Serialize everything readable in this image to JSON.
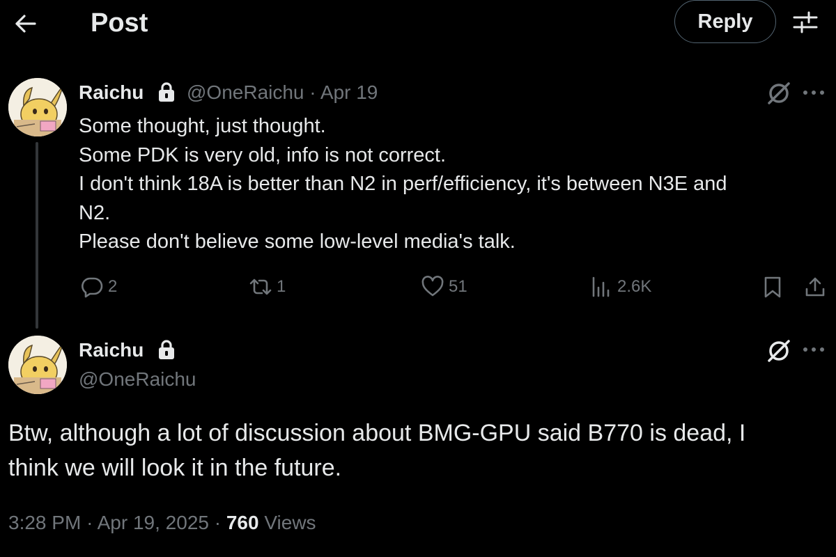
{
  "header": {
    "title": "Post",
    "reply_label": "Reply"
  },
  "tweet1": {
    "name": "Raichu",
    "handle": "@OneRaichu",
    "date": "Apr 19",
    "lines": [
      "Some thought, just thought.",
      "Some PDK is very old, info is not correct.",
      "I don't think 18A is better than N2 in perf/efficiency, it's between N3E and",
      "N2.",
      "Please don't believe some low-level media's talk."
    ],
    "actions": {
      "replies": "2",
      "reposts": "1",
      "likes": "51",
      "views": "2.6K"
    }
  },
  "tweet2": {
    "name": "Raichu",
    "handle": "@OneRaichu",
    "lines": [
      "Btw, although a lot of discussion about BMG-GPU said B770 is dead, I",
      "think we will look it in the future."
    ],
    "time": "3:28 PM",
    "date": "Apr 19, 2025",
    "views_count": "760",
    "views_label": "Views"
  },
  "icons": {
    "back": "arrow-left-icon",
    "filter": "sliders-icon",
    "lock": "lock-icon",
    "grok": "grok-icon",
    "more": "more-horizontal-icon",
    "reply": "comment-icon",
    "repost": "repost-icon",
    "like": "heart-icon",
    "views": "analytics-icon",
    "bookmark": "bookmark-icon",
    "share": "share-icon"
  },
  "colors": {
    "background": "#000000",
    "text_primary": "#e7e9ea",
    "text_secondary": "#71767b",
    "border": "#536471"
  }
}
